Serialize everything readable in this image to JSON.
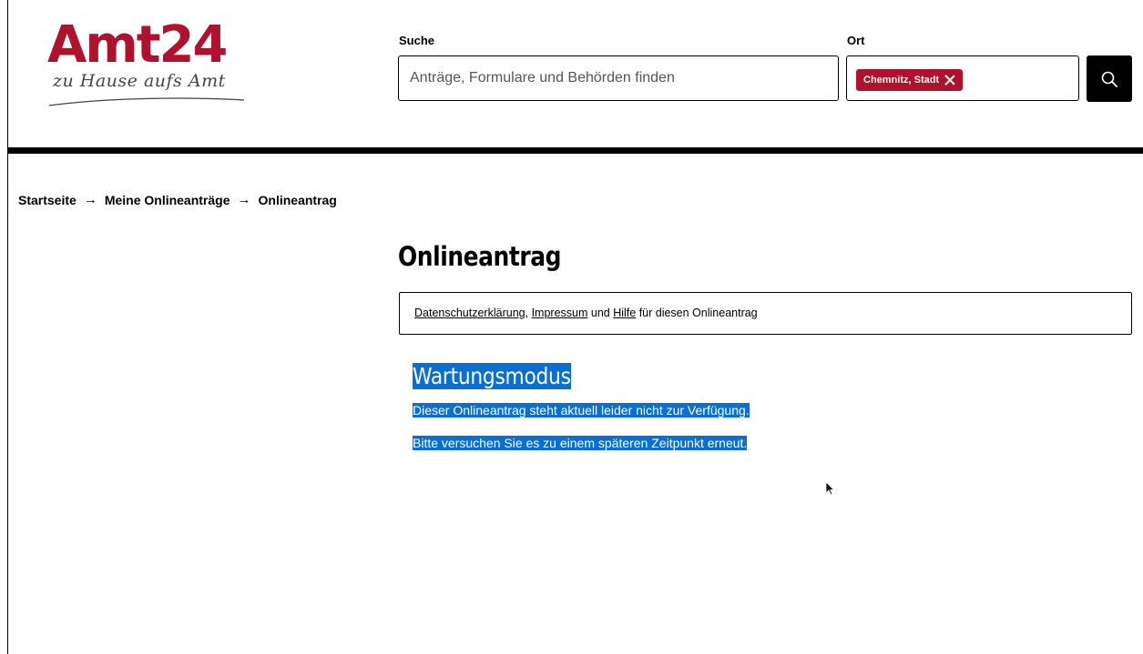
{
  "header": {
    "logo_text": "Amt24",
    "logo_tagline": "zu Hause aufs Amt",
    "search_label": "Suche",
    "search_placeholder": "Anträge, Formulare und Behörden finden",
    "ort_label": "Ort",
    "ort_chip": "Chemnitz, Stadt",
    "search_button_icon": "search-icon",
    "brand_color": "#b0122e"
  },
  "breadcrumb": {
    "items": [
      "Startseite",
      "Meine Onlineanträge",
      "Onlineantrag"
    ],
    "separator_icon": "arrow-right-icon"
  },
  "main": {
    "title": "Onlineantrag",
    "info": {
      "link_privacy": "Datenschutzerklärung",
      "sep1": ", ",
      "link_imprint": "Impressum",
      "sep2": " und ",
      "link_help": "Hilfe",
      "suffix": " für diesen Onlineantrag"
    },
    "maintenance": {
      "title": "Wartungsmodus",
      "line1": "Dieser Onlineantrag steht aktuell leider nicht zur Verfügung.",
      "line2": "Bitte versuchen Sie es zu einem späteren Zeitpunkt erneut.",
      "selection_color": "#0a6fd0"
    }
  }
}
